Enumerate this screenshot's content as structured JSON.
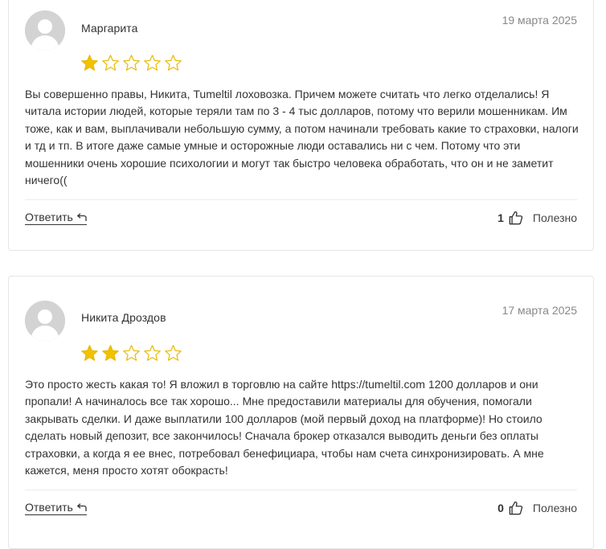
{
  "reviews": [
    {
      "author": "Маргарита",
      "date": "19 марта 2025",
      "rating": 1,
      "rating_max": 5,
      "text": "Вы совершенно правы, Никита, Tumeltil лоховозка. Причем можете считать что легко отделались! Я читала истории людей, которые теряли там по 3 - 4 тыс долларов, потому что верили мошенникам. Им тоже, как и вам, выплачивали небольшую сумму, а потом начинали требовать какие то страховки, налоги и тд и тп. В итоге даже самые умные и осторожные люди оставались ни с чем. Потому что эти мошенники очень хорошие психологии и могут так быстро человека обработать, что он и не заметит ничего((",
      "reply_label": "Ответить",
      "useful_count": "1",
      "useful_label": "Полезно"
    },
    {
      "author": "Никита Дроздов",
      "date": "17 марта 2025",
      "rating": 2,
      "rating_max": 5,
      "text": "Это просто жесть какая то! Я вложил в торговлю на сайте https://tumeltil.com 1200 долларов и они пропали! А начиналось все так хорошо... Мне предоставили материалы для обучения, помогали закрывать сделки. И даже выплатили 100 долларов (мой первый доход на платформе)! Но стоило сделать новый депозит, все закончилось! Сначала брокер отказался выводить деньги без оплаты страховки, а когда я ее внес, потребовал бенефициара, чтобы нам счета синхронизировать. А мне кажется, меня просто хотят обокрасть!",
      "reply_label": "Ответить",
      "useful_count": "0",
      "useful_label": "Полезно"
    }
  ],
  "colors": {
    "star_filled": "#f2c200",
    "star_outline": "#e8b800",
    "avatar_bg": "#d3d3d3",
    "avatar_fg": "#ffffff",
    "date_text": "#888888",
    "border": "#e6e6e6"
  },
  "icons": {
    "avatar": "user-placeholder-icon",
    "star": "star-icon",
    "reply": "reply-arrow-icon",
    "like": "thumbs-up-icon"
  }
}
